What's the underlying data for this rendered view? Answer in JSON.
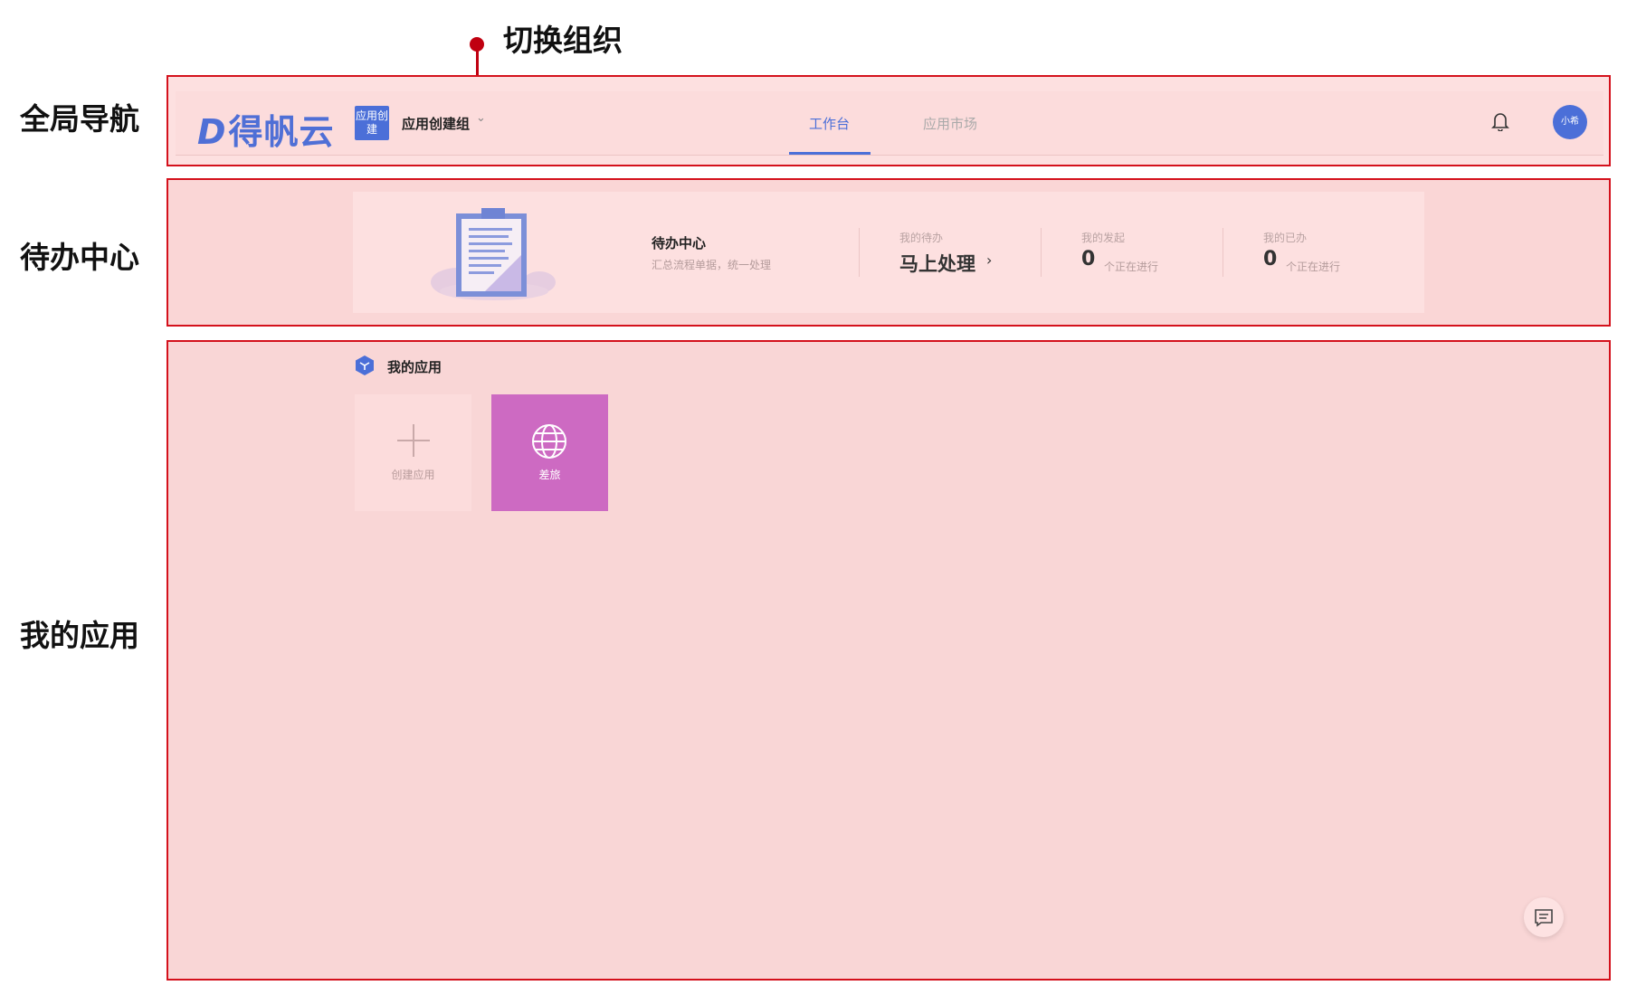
{
  "annotations": {
    "callout": "切换组织",
    "labels": {
      "nav": "全局导航",
      "todo": "待办中心",
      "apps": "我的应用"
    }
  },
  "nav": {
    "logo": "得帆云",
    "org_badge": "应用创建",
    "org_name": "应用创建组",
    "tabs": [
      "工作台",
      "应用市场"
    ],
    "active_tab": "工作台",
    "avatar": "小希"
  },
  "todo": {
    "title": "待办中心",
    "subtitle": "汇总流程单据，统一处理",
    "my_todo": {
      "label": "我的待办",
      "action": "马上处理"
    },
    "initiated": {
      "label": "我的发起",
      "value": "0",
      "unit": "个正在进行"
    },
    "done": {
      "label": "我的已办",
      "value": "0",
      "unit": "个正在进行"
    }
  },
  "apps": {
    "title": "我的应用",
    "create_label": "创建应用",
    "items": [
      {
        "label": "差旅",
        "color": "#cd6ac2"
      }
    ]
  },
  "colors": {
    "accent": "#4b6fd8",
    "annotation": "#d4111c"
  }
}
